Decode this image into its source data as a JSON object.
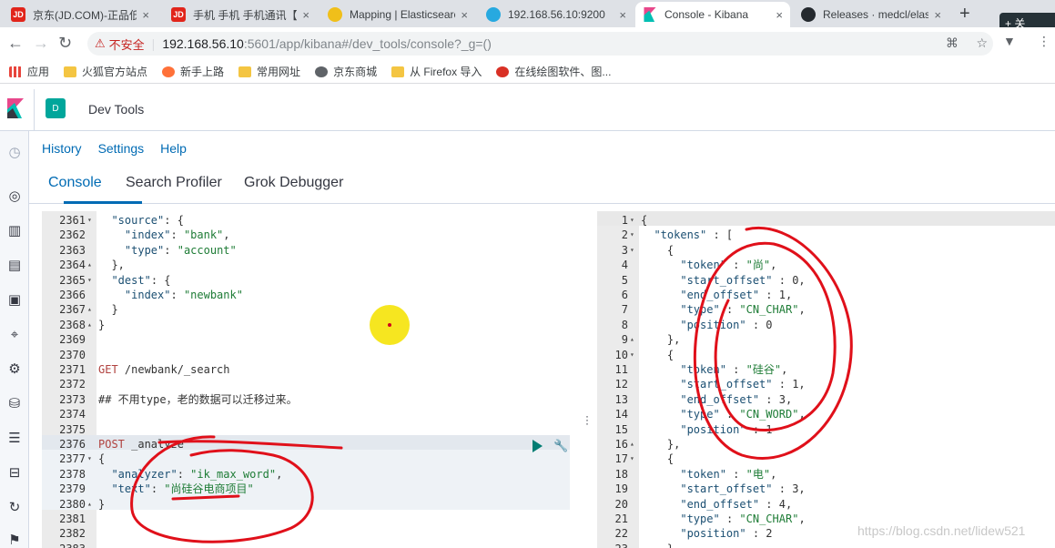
{
  "browser": {
    "tabs": [
      {
        "title": "京东(JD.COM)-正品低价",
        "favicon": "JD",
        "color": "#e1251b"
      },
      {
        "title": "手机 手机 手机通讯【价",
        "favicon": "JD",
        "color": "#e1251b"
      },
      {
        "title": "Mapping | Elasticsearch",
        "favicon": "elastic",
        "color": "#f0bf1a"
      },
      {
        "title": "192.168.56.10:9200",
        "favicon": "es",
        "color": "#27a9e0"
      },
      {
        "title": "Console - Kibana",
        "favicon": "K",
        "color": "#e8478b"
      },
      {
        "title": "Releases · medcl/elastic",
        "favicon": "gh",
        "color": "#24292e"
      }
    ],
    "corner_label": "+ 关",
    "insecure_label": "不安全",
    "url_host": "192.168.56.10",
    "url_path": ":5601/app/kibana#/dev_tools/console?_g=()",
    "bookmarks": [
      "应用",
      "火狐官方站点",
      "新手上路",
      "常用网址",
      "京东商城",
      "从 Firefox 导入",
      "在线绘图软件、图..."
    ]
  },
  "kibana": {
    "space_initial": "D",
    "breadcrumb": "Dev Tools",
    "top_menu": [
      "History",
      "Settings",
      "Help"
    ],
    "tabs": [
      "Console",
      "Search Profiler",
      "Grok Debugger"
    ],
    "active_tab": "Console"
  },
  "request_editor": {
    "lines": [
      {
        "n": "2361",
        "fold": "▾",
        "code": "  \"source\": {"
      },
      {
        "n": "2362",
        "fold": "",
        "code": "    \"index\": \"bank\","
      },
      {
        "n": "2363",
        "fold": "",
        "code": "    \"type\": \"account\""
      },
      {
        "n": "2364",
        "fold": "▴",
        "code": "  },"
      },
      {
        "n": "2365",
        "fold": "▾",
        "code": "  \"dest\": {"
      },
      {
        "n": "2366",
        "fold": "",
        "code": "    \"index\": \"newbank\""
      },
      {
        "n": "2367",
        "fold": "▴",
        "code": "  }"
      },
      {
        "n": "2368",
        "fold": "▴",
        "code": "}"
      },
      {
        "n": "2369",
        "fold": "",
        "code": ""
      },
      {
        "n": "2370",
        "fold": "",
        "code": ""
      },
      {
        "n": "2371",
        "fold": "",
        "code": "GET /newbank/_search"
      },
      {
        "n": "2372",
        "fold": "",
        "code": ""
      },
      {
        "n": "2373",
        "fold": "",
        "code": "## 不用type，老的数据可以迁移过来。"
      },
      {
        "n": "2374",
        "fold": "",
        "code": ""
      },
      {
        "n": "2375",
        "fold": "",
        "code": ""
      },
      {
        "n": "2376",
        "fold": "",
        "code": "POST _analyze"
      },
      {
        "n": "2377",
        "fold": "▾",
        "code": "{"
      },
      {
        "n": "2378",
        "fold": "",
        "code": "  \"analyzer\": \"ik_max_word\","
      },
      {
        "n": "2379",
        "fold": "",
        "code": "  \"text\": \"尚硅谷电商项目\""
      },
      {
        "n": "2380",
        "fold": "▴",
        "code": "}"
      },
      {
        "n": "2381",
        "fold": "",
        "code": ""
      },
      {
        "n": "2382",
        "fold": "",
        "code": ""
      },
      {
        "n": "2383",
        "fold": "",
        "code": ""
      }
    ]
  },
  "response_editor": {
    "lines": [
      {
        "n": "1",
        "fold": "▾",
        "code": "{"
      },
      {
        "n": "2",
        "fold": "▾",
        "code": "  \"tokens\" : ["
      },
      {
        "n": "3",
        "fold": "▾",
        "code": "    {"
      },
      {
        "n": "4",
        "fold": "",
        "code": "      \"token\" : \"尚\","
      },
      {
        "n": "5",
        "fold": "",
        "code": "      \"start_offset\" : 0,"
      },
      {
        "n": "6",
        "fold": "",
        "code": "      \"end_offset\" : 1,"
      },
      {
        "n": "7",
        "fold": "",
        "code": "      \"type\" : \"CN_CHAR\","
      },
      {
        "n": "8",
        "fold": "",
        "code": "      \"position\" : 0"
      },
      {
        "n": "9",
        "fold": "▴",
        "code": "    },"
      },
      {
        "n": "10",
        "fold": "▾",
        "code": "    {"
      },
      {
        "n": "11",
        "fold": "",
        "code": "      \"token\" : \"硅谷\","
      },
      {
        "n": "12",
        "fold": "",
        "code": "      \"start_offset\" : 1,"
      },
      {
        "n": "13",
        "fold": "",
        "code": "      \"end_offset\" : 3,"
      },
      {
        "n": "14",
        "fold": "",
        "code": "      \"type\" : \"CN_WORD\","
      },
      {
        "n": "15",
        "fold": "",
        "code": "      \"position\" : 1"
      },
      {
        "n": "16",
        "fold": "▴",
        "code": "    },"
      },
      {
        "n": "17",
        "fold": "▾",
        "code": "    {"
      },
      {
        "n": "18",
        "fold": "",
        "code": "      \"token\" : \"电\","
      },
      {
        "n": "19",
        "fold": "",
        "code": "      \"start_offset\" : 3,"
      },
      {
        "n": "20",
        "fold": "",
        "code": "      \"end_offset\" : 4,"
      },
      {
        "n": "21",
        "fold": "",
        "code": "      \"type\" : \"CN_CHAR\","
      },
      {
        "n": "22",
        "fold": "",
        "code": "      \"position\" : 2"
      },
      {
        "n": "23",
        "fold": "",
        "code": "    },"
      }
    ]
  },
  "watermark": "https://blog.csdn.net/lidew521",
  "colors": {
    "kibana_accent": "#006bb4",
    "space_badge": "#00a69b",
    "annotation_red": "#e0101a",
    "cursor_highlight": "#f6e620"
  }
}
